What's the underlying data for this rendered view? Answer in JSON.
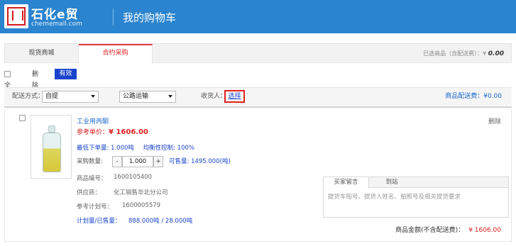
{
  "header": {
    "logo_text": "石化e贸",
    "logo_url": "chememall.com",
    "page_title": "我的购物车"
  },
  "tabs": [
    {
      "label": "现货商城"
    },
    {
      "label": "合约采购"
    }
  ],
  "selected_info": {
    "label": "已选商品（含配送费）：¥",
    "amount": "0.00"
  },
  "toolbar": {
    "select_all": "全选",
    "delete": "删除",
    "valid": "有效"
  },
  "shipping": {
    "method_label": "配送方式：",
    "method_value": "自提",
    "transport_value": "公路运输",
    "receiver_label": "收货人：",
    "choose": "选择",
    "fee": "商品配送费：¥0.00"
  },
  "item": {
    "name": "工业用丙酮",
    "price_label": "参考单价：",
    "price": "¥ 1606.00",
    "delete": "删除",
    "min_order": "最低下单量: 1.000吨",
    "balance": "均衡性控制: 100%",
    "qty_label": "采购数量:",
    "qty_minus": "-",
    "qty_value": "1.000",
    "qty_plus": "+",
    "available": "可售量: 1495.000(吨)",
    "code_label": "商品编号：",
    "code_value": "1600105400",
    "supplier_label": "供应商：",
    "supplier_value": "化工销售华北分公司",
    "plan_label": "参考计划号：",
    "plan_value": "1600005579",
    "planned_label": "计划量/已售量：",
    "planned_value": "888.000吨 / 28.000吨",
    "msg_tab1": "买家留言",
    "msg_tab2": "到站",
    "msg_placeholder": "提货车船号、提货人姓名、舶照号及相关提货要求",
    "total_label": "商品金额(不含配送费)：",
    "total_value": "¥ 1606.00"
  }
}
